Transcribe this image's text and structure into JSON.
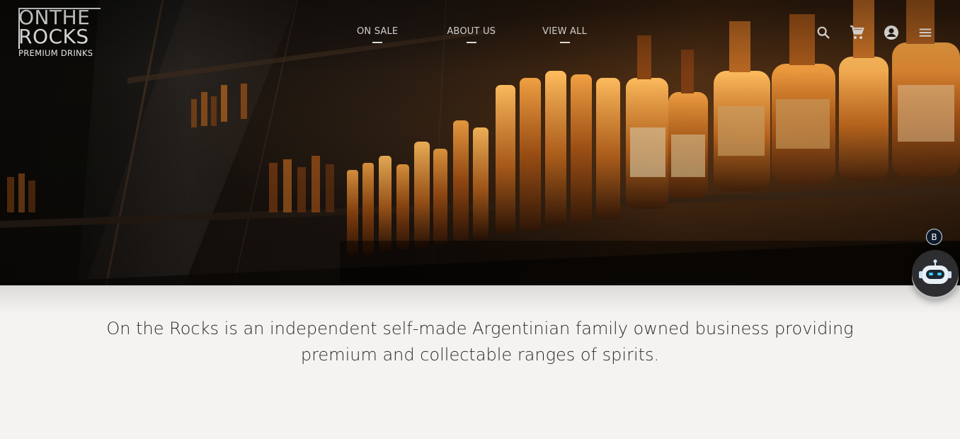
{
  "logo": {
    "line1": "ONTHE",
    "line2": "ROCKS",
    "tagline": "PREMIUM DRINKS"
  },
  "nav": {
    "items": [
      {
        "label": "ON SALE"
      },
      {
        "label": "ABOUT US"
      },
      {
        "label": "VIEW ALL"
      }
    ]
  },
  "tools": {
    "icons": [
      "search-icon",
      "cart-icon",
      "account-icon",
      "menu-icon"
    ]
  },
  "intro": {
    "text": "On the Rocks is an independent self-made Argentinian family owned business providing premium and collectable ranges of spirits."
  },
  "chatbot": {
    "badge": "B",
    "icon": "robot-icon"
  },
  "colors": {
    "page_bg": "#f4f3f1",
    "text": "#2a2a2a",
    "nav_text": "#ffffff",
    "amber": "#e08a2a"
  }
}
